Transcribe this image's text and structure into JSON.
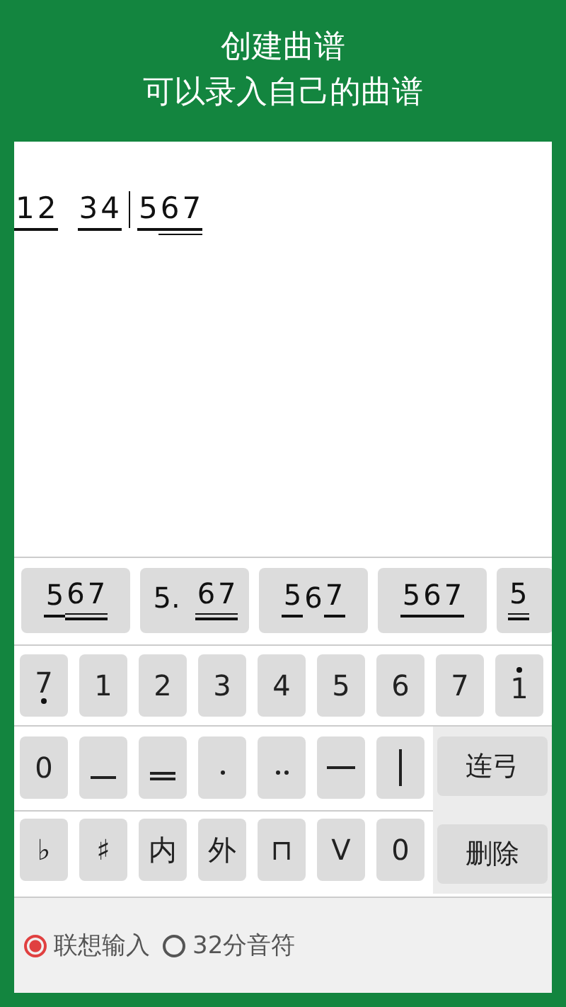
{
  "header": {
    "title": "创建曲谱",
    "subtitle": "可以录入自己的曲谱"
  },
  "score": [
    {
      "kind": "note",
      "text": "1",
      "underline": true,
      "double_underline": false
    },
    {
      "kind": "note",
      "text": "2",
      "underline": true,
      "double_underline": false
    },
    {
      "kind": "space"
    },
    {
      "kind": "note",
      "text": "3",
      "underline": true,
      "double_underline": false
    },
    {
      "kind": "note",
      "text": "4",
      "underline": true,
      "double_underline": false
    },
    {
      "kind": "bar"
    },
    {
      "kind": "note",
      "text": "5",
      "underline": true,
      "double_underline": false
    },
    {
      "kind": "note",
      "text": "6",
      "underline": true,
      "double_underline": true
    },
    {
      "kind": "note",
      "text": "7",
      "underline": true,
      "double_underline": true
    }
  ],
  "suggestions": [
    [
      {
        "kind": "note",
        "text": "5",
        "underline": true,
        "double_underline": false
      },
      {
        "kind": "note",
        "text": "6",
        "underline": true,
        "double_underline": true
      },
      {
        "kind": "note",
        "text": "7",
        "underline": true,
        "double_underline": true
      }
    ],
    [
      {
        "kind": "note",
        "text": "5.",
        "underline": false,
        "double_underline": false
      },
      {
        "kind": "space"
      },
      {
        "kind": "note",
        "text": "6",
        "underline": true,
        "double_underline": true
      },
      {
        "kind": "note",
        "text": "7",
        "underline": true,
        "double_underline": true
      }
    ],
    [
      {
        "kind": "note",
        "text": "5",
        "underline": true,
        "double_underline": false
      },
      {
        "kind": "note",
        "text": "6",
        "underline": false,
        "double_underline": false
      },
      {
        "kind": "note",
        "text": "7",
        "underline": true,
        "double_underline": false
      }
    ],
    [
      {
        "kind": "note",
        "text": "5",
        "underline": true,
        "double_underline": false
      },
      {
        "kind": "note",
        "text": "6",
        "underline": true,
        "double_underline": false
      },
      {
        "kind": "note",
        "text": "7",
        "underline": true,
        "double_underline": false
      }
    ],
    [
      {
        "kind": "note",
        "text": "5",
        "underline": true,
        "double_underline": true
      }
    ]
  ],
  "number_keys": [
    {
      "text": "7",
      "dot_above": false,
      "dot_below": true
    },
    {
      "text": "1",
      "dot_above": false,
      "dot_below": false
    },
    {
      "text": "2",
      "dot_above": false,
      "dot_below": false
    },
    {
      "text": "3",
      "dot_above": false,
      "dot_below": false
    },
    {
      "text": "4",
      "dot_above": false,
      "dot_below": false
    },
    {
      "text": "5",
      "dot_above": false,
      "dot_below": false
    },
    {
      "text": "6",
      "dot_above": false,
      "dot_below": false
    },
    {
      "text": "7",
      "dot_above": false,
      "dot_below": false
    },
    {
      "text": "1",
      "dot_above": true,
      "dot_below": false
    }
  ],
  "symbol_keys": [
    {
      "kind": "text",
      "text": "0"
    },
    {
      "kind": "single-line"
    },
    {
      "kind": "double-line"
    },
    {
      "kind": "dot"
    },
    {
      "kind": "double-dot"
    },
    {
      "kind": "dash"
    },
    {
      "kind": "barline"
    }
  ],
  "mark_keys": [
    {
      "kind": "text",
      "text": "♭"
    },
    {
      "kind": "text",
      "text": "♯"
    },
    {
      "kind": "text",
      "text": "内"
    },
    {
      "kind": "text",
      "text": "外"
    },
    {
      "kind": "text",
      "text": "⊓"
    },
    {
      "kind": "text",
      "text": "V"
    },
    {
      "kind": "text",
      "text": "0"
    }
  ],
  "side_keys": [
    {
      "text": "连弓"
    },
    {
      "text": "删除"
    }
  ],
  "input_modes": [
    {
      "label": "联想输入",
      "selected": true
    },
    {
      "label": "32分音符",
      "selected": false
    }
  ]
}
